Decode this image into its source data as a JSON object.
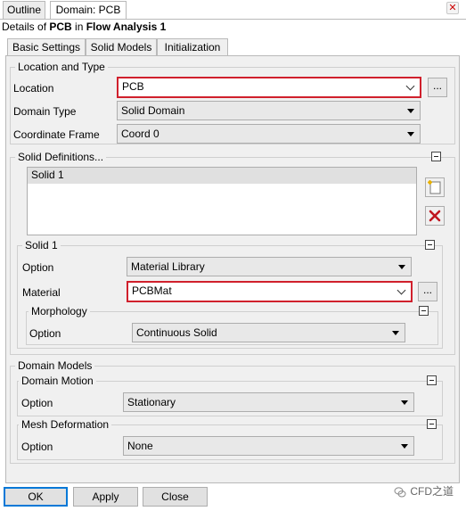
{
  "top_tabs": [
    "Outline",
    "Domain: PCB"
  ],
  "details": {
    "prefix": "Details of ",
    "object": "PCB",
    "mid": " in ",
    "analysis": "Flow Analysis 1"
  },
  "inner_tabs": [
    "Basic Settings",
    "Solid Models",
    "Initialization"
  ],
  "location_and_type": {
    "title": "Location and Type",
    "location_label": "Location",
    "location_value": "PCB",
    "location_browse": "...",
    "domain_type_label": "Domain Type",
    "domain_type_value": "Solid Domain",
    "coord_frame_label": "Coordinate Frame",
    "coord_frame_value": "Coord 0"
  },
  "solid_definitions": {
    "title": "Solid Definitions...",
    "items": [
      "Solid 1"
    ]
  },
  "solid1": {
    "title": "Solid 1",
    "option_label": "Option",
    "option_value": "Material Library",
    "material_label": "Material",
    "material_value": "PCBMat",
    "material_browse": "...",
    "morphology": {
      "title": "Morphology",
      "option_label": "Option",
      "option_value": "Continuous Solid"
    }
  },
  "domain_models": {
    "title": "Domain Models",
    "domain_motion": {
      "title": "Domain Motion",
      "option_label": "Option",
      "option_value": "Stationary"
    },
    "mesh_deformation": {
      "title": "Mesh Deformation",
      "option_label": "Option",
      "option_value": "None"
    }
  },
  "buttons": {
    "ok": "OK",
    "apply": "Apply",
    "close": "Close"
  },
  "watermark": "CFD之道",
  "colors": {
    "highlight_border": "#d0202c",
    "panel_bg": "#f0f0f0",
    "default_button_border": "#0078d7",
    "delete_icon": "#c0161f"
  }
}
